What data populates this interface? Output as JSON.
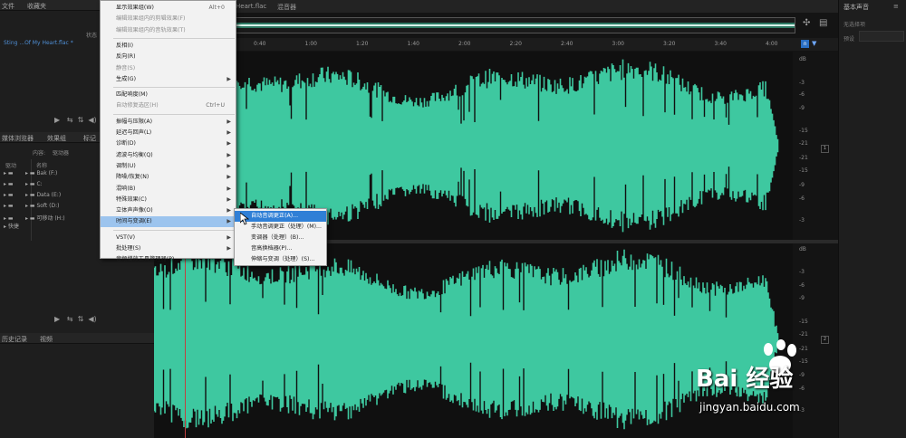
{
  "left": {
    "top_tabs": [
      "文件",
      "收藏夹"
    ],
    "file_item": "Sting ...Of My Heart.flac *",
    "status_label": "状态",
    "browser_tabs": [
      "媒体浏览器",
      "效果组",
      "标记"
    ],
    "content_label": "内容:",
    "content_value": "驱动器",
    "left_col_label": "驱动",
    "name_col_label": "名称",
    "drives": [
      "Bak (F:)",
      "C:",
      "Data (E:)",
      "Soft (D:)",
      "可移动 (H:)"
    ],
    "shortcut_label": "快捷",
    "bottom_tabs": [
      "历史记录",
      "视频"
    ]
  },
  "menu": {
    "items": [
      {
        "label": "显示效果组(W)",
        "shortcut": "Alt+0",
        "arrow": false,
        "disabled": false
      },
      {
        "label": "编辑效果组内的剪辑效果(F)",
        "shortcut": "",
        "arrow": false,
        "disabled": true
      },
      {
        "label": "编辑效果组内的音轨效果(T)",
        "shortcut": "",
        "arrow": false,
        "disabled": true
      },
      {
        "sep": true
      },
      {
        "label": "反相(I)",
        "shortcut": "",
        "arrow": false,
        "disabled": false
      },
      {
        "label": "反向(R)",
        "shortcut": "",
        "arrow": false,
        "disabled": false
      },
      {
        "label": "静音(S)",
        "shortcut": "",
        "arrow": false,
        "disabled": true
      },
      {
        "label": "生成(G)",
        "shortcut": "",
        "arrow": true,
        "disabled": false
      },
      {
        "sep": true
      },
      {
        "label": "匹配响度(M)",
        "shortcut": "",
        "arrow": false,
        "disabled": false
      },
      {
        "label": "自动修复选区(H)",
        "shortcut": "Ctrl+U",
        "arrow": false,
        "disabled": true
      },
      {
        "sep": true
      },
      {
        "label": "振幅与压限(A)",
        "shortcut": "",
        "arrow": true,
        "disabled": false
      },
      {
        "label": "延迟与回声(L)",
        "shortcut": "",
        "arrow": true,
        "disabled": false
      },
      {
        "label": "诊断(D)",
        "shortcut": "",
        "arrow": true,
        "disabled": false
      },
      {
        "label": "滤波与均衡(Q)",
        "shortcut": "",
        "arrow": true,
        "disabled": false
      },
      {
        "label": "调制(U)",
        "shortcut": "",
        "arrow": true,
        "disabled": false
      },
      {
        "label": "降噪/恢复(N)",
        "shortcut": "",
        "arrow": true,
        "disabled": false
      },
      {
        "label": "混响(B)",
        "shortcut": "",
        "arrow": true,
        "disabled": false
      },
      {
        "label": "特殊效果(C)",
        "shortcut": "",
        "arrow": true,
        "disabled": false
      },
      {
        "label": "立体声声像(O)",
        "shortcut": "",
        "arrow": true,
        "disabled": false
      },
      {
        "label": "时间与变调(E)",
        "shortcut": "",
        "arrow": true,
        "disabled": false,
        "active": true
      },
      {
        "sep": true
      },
      {
        "label": "VST(V)",
        "shortcut": "",
        "arrow": true,
        "disabled": false
      },
      {
        "label": "批处理(S)",
        "shortcut": "",
        "arrow": true,
        "disabled": false
      },
      {
        "label": "音频增效工具管理器(P)...",
        "shortcut": "",
        "arrow": false,
        "disabled": false
      }
    ]
  },
  "submenu": {
    "items": [
      {
        "label": "自动音调更正(A)...",
        "active": true
      },
      {
        "label": "手动音调更正（处理）(M)...",
        "active": false
      },
      {
        "label": "变调器（处理）(B)...",
        "active": false
      },
      {
        "label": "音高换档器(P)...",
        "active": false
      },
      {
        "label": "伸缩与变调（处理）(S)...",
        "active": false
      }
    ]
  },
  "editor": {
    "tabs": [
      "Heart.flac",
      "混音器"
    ],
    "ruler_ticks": [
      "0:40",
      "1:00",
      "1:20",
      "1:40",
      "2:00",
      "2:20",
      "2:40",
      "3:00",
      "3:20",
      "3:40",
      "4:00"
    ],
    "db_scale_top": [
      "dB",
      "-3",
      "-6",
      "-9",
      "-15",
      "-21",
      "-21",
      "-15",
      "-9",
      "-6",
      "-3"
    ],
    "db_scale_bottom": [
      "dB",
      "-3",
      "-6",
      "-9",
      "-15",
      "-21",
      "-21",
      "-15",
      "-9",
      "-6",
      "-3"
    ],
    "channel_labels": [
      "1",
      "2"
    ],
    "wave_color": "#3ec8a0"
  },
  "right": {
    "title": "基本声音",
    "subtitle": "无选择项",
    "preset_label": "预设"
  },
  "watermark": {
    "logo_text": "Bai  经验",
    "url": "jingyan.baidu.com"
  }
}
